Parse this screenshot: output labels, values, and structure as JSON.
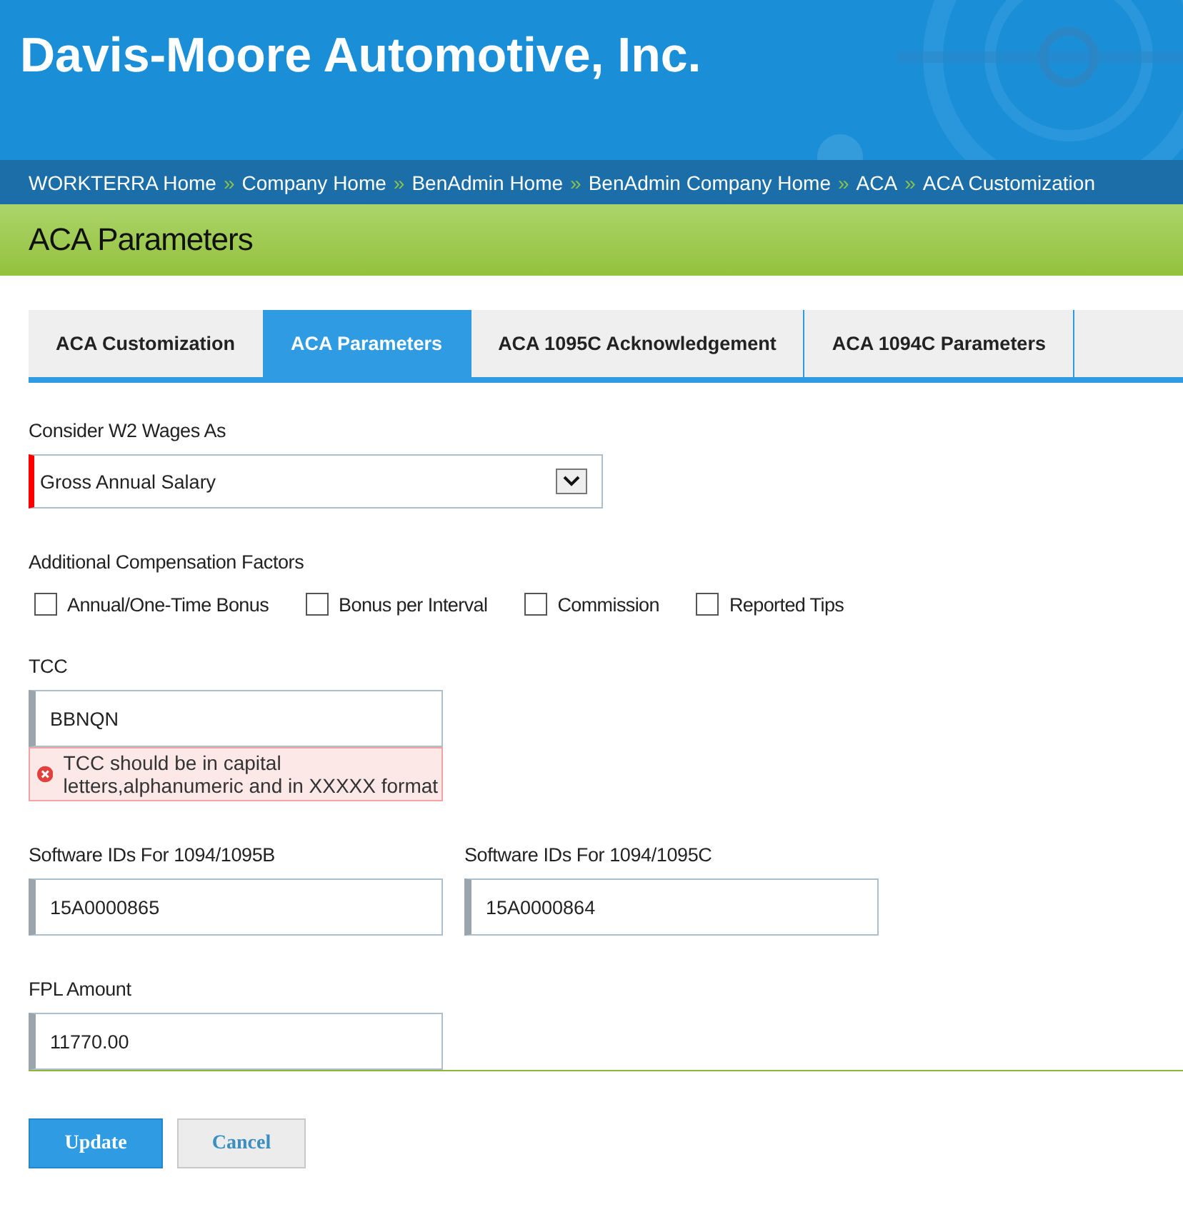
{
  "header": {
    "company": "Davis-Moore Automotive, Inc."
  },
  "breadcrumb": [
    {
      "label": "WORKTERRA Home"
    },
    {
      "label": "Company Home"
    },
    {
      "label": "BenAdmin Home"
    },
    {
      "label": "BenAdmin Company Home"
    },
    {
      "label": "ACA"
    },
    {
      "label": "ACA Customization"
    }
  ],
  "breadcrumb_separator": "»",
  "page_title": "ACA Parameters",
  "tabs": [
    {
      "label": "ACA Customization",
      "selected": false
    },
    {
      "label": "ACA Parameters",
      "selected": true
    },
    {
      "label": "ACA 1095C Acknowledgement",
      "selected": false
    },
    {
      "label": "ACA 1094C Parameters",
      "selected": false
    }
  ],
  "wages": {
    "label": "Consider W2 Wages As",
    "value": "Gross Annual Salary",
    "required": true
  },
  "compensation": {
    "label": "Additional Compensation Factors",
    "options": [
      {
        "label": "Annual/One-Time Bonus",
        "checked": false
      },
      {
        "label": "Bonus per Interval",
        "checked": false
      },
      {
        "label": "Commission",
        "checked": false
      },
      {
        "label": "Reported Tips",
        "checked": false
      }
    ]
  },
  "tcc": {
    "label": "TCC",
    "value": "BBNQN",
    "error": "TCC should be in capital letters,alphanumeric and in XXXXX format"
  },
  "software_ids": [
    {
      "label": "Software IDs For 1094/1095B",
      "value": "15A0000865"
    },
    {
      "label": "Software IDs For 1094/1095C",
      "value": "15A0000864"
    }
  ],
  "fpl": {
    "label": "FPL Amount",
    "value": "11770.00"
  },
  "buttons": [
    {
      "label": "Update",
      "kind": "primary"
    },
    {
      "label": "Cancel",
      "kind": "secondary"
    }
  ]
}
